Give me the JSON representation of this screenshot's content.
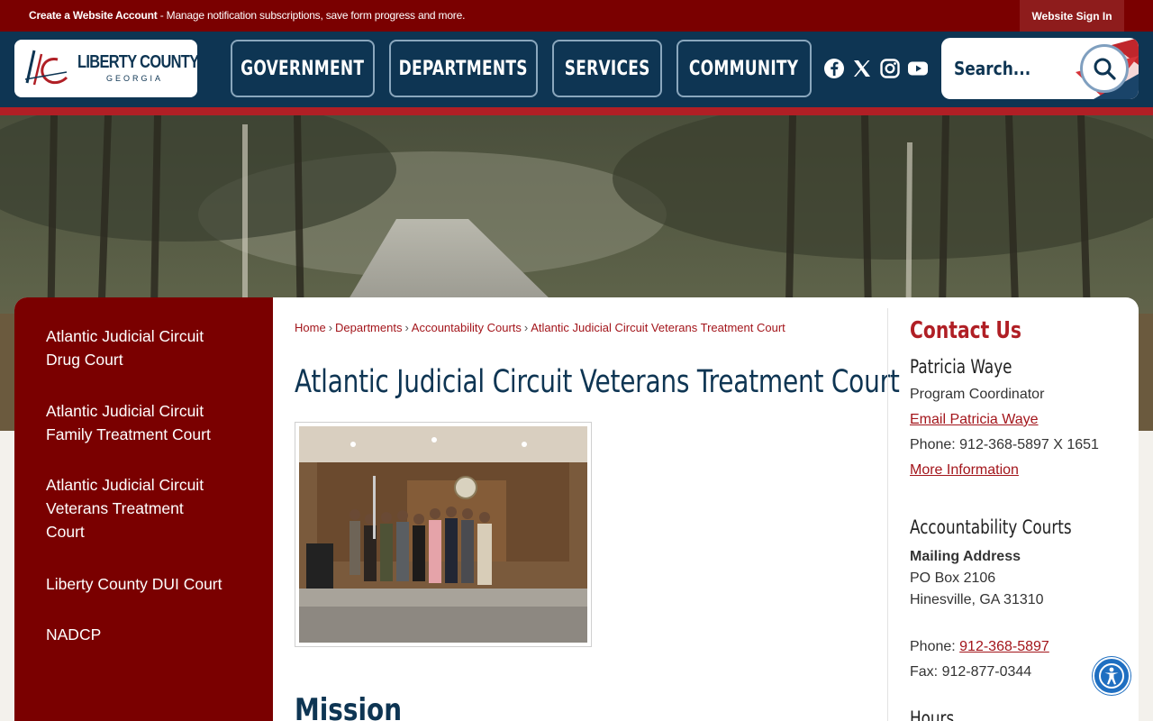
{
  "topbar": {
    "create_account": "Create a Website Account",
    "create_account_desc": " - Manage notification subscriptions, save form progress and more.",
    "sign_in": "Website Sign In"
  },
  "logo": {
    "name": "LIBERTY COUNTY",
    "sub": "GEORGIA"
  },
  "nav": [
    "GOVERNMENT",
    "DEPARTMENTS",
    "SERVICES",
    "COMMUNITY"
  ],
  "social": [
    "facebook-icon",
    "x-icon",
    "instagram-icon",
    "youtube-icon"
  ],
  "search": {
    "placeholder": "Search..."
  },
  "sidebar": [
    "Atlantic Judicial Circuit Drug Court",
    "Atlantic Judicial Circuit Family Treatment Court",
    "Atlantic Judicial Circuit Veterans Treatment Court",
    "Liberty County DUI Court",
    "NADCP"
  ],
  "breadcrumb": [
    "Home",
    "Departments",
    "Accountability Courts",
    "Atlantic Judicial Circuit Veterans Treatment Court"
  ],
  "page_title": "Atlantic Judicial Circuit Veterans Treatment Court",
  "section_heading": "Mission",
  "contact": {
    "heading": "Contact Us",
    "name": "Patricia Waye",
    "role": "Program Coordinator",
    "email_link": "Email Patricia Waye",
    "phone": "Phone: 912-368-5897 X 1651",
    "more_info": "More Information",
    "section": "Accountability Courts",
    "mailing_label": "Mailing Address",
    "po_box": "PO Box 2106",
    "city": "Hinesville, GA 31310",
    "phone_label": "Phone: ",
    "phone_link": "912-368-5897",
    "fax": "Fax: 912-877-0344",
    "hours": "Hours"
  },
  "colors": {
    "brand_red": "#7a0000",
    "navy": "#0e3553",
    "accent_red": "#b01f25"
  }
}
